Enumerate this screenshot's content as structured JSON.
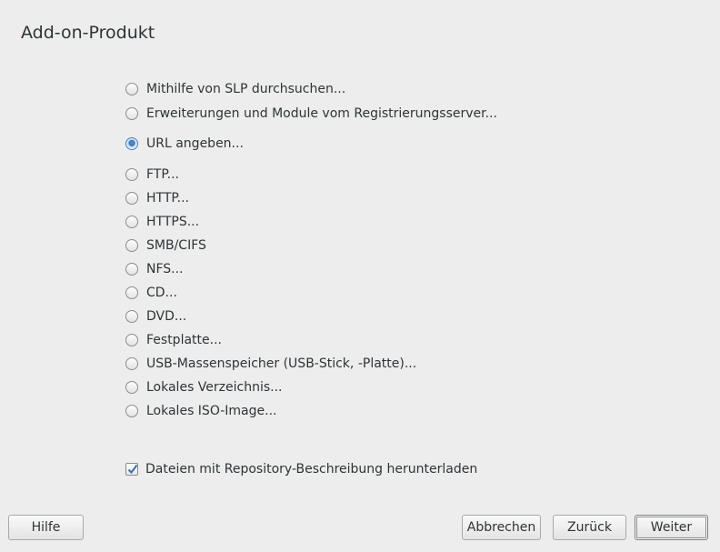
{
  "title": "Add-on-Produkt",
  "options": [
    {
      "label": "Mithilfe von SLP durchsuchen...",
      "checked": false
    },
    {
      "label": "Erweiterungen und Module vom Registrierungsserver...",
      "checked": false
    },
    {
      "label": "URL angeben...",
      "checked": true
    },
    {
      "label": "FTP...",
      "checked": false
    },
    {
      "label": "HTTP...",
      "checked": false
    },
    {
      "label": "HTTPS...",
      "checked": false
    },
    {
      "label": "SMB/CIFS",
      "checked": false
    },
    {
      "label": "NFS...",
      "checked": false
    },
    {
      "label": "CD...",
      "checked": false
    },
    {
      "label": "DVD...",
      "checked": false
    },
    {
      "label": "Festplatte...",
      "checked": false
    },
    {
      "label": "USB-Massenspeicher (USB-Stick, -Platte)...",
      "checked": false
    },
    {
      "label": "Lokales Verzeichnis...",
      "checked": false
    },
    {
      "label": "Lokales ISO-Image...",
      "checked": false
    }
  ],
  "download_checkbox": {
    "label": "Dateien mit Repository-Beschreibung herunterladen",
    "checked": true
  },
  "buttons": {
    "help": "Hilfe",
    "cancel": "Abbrechen",
    "back": "Zurück",
    "next": "Weiter"
  }
}
